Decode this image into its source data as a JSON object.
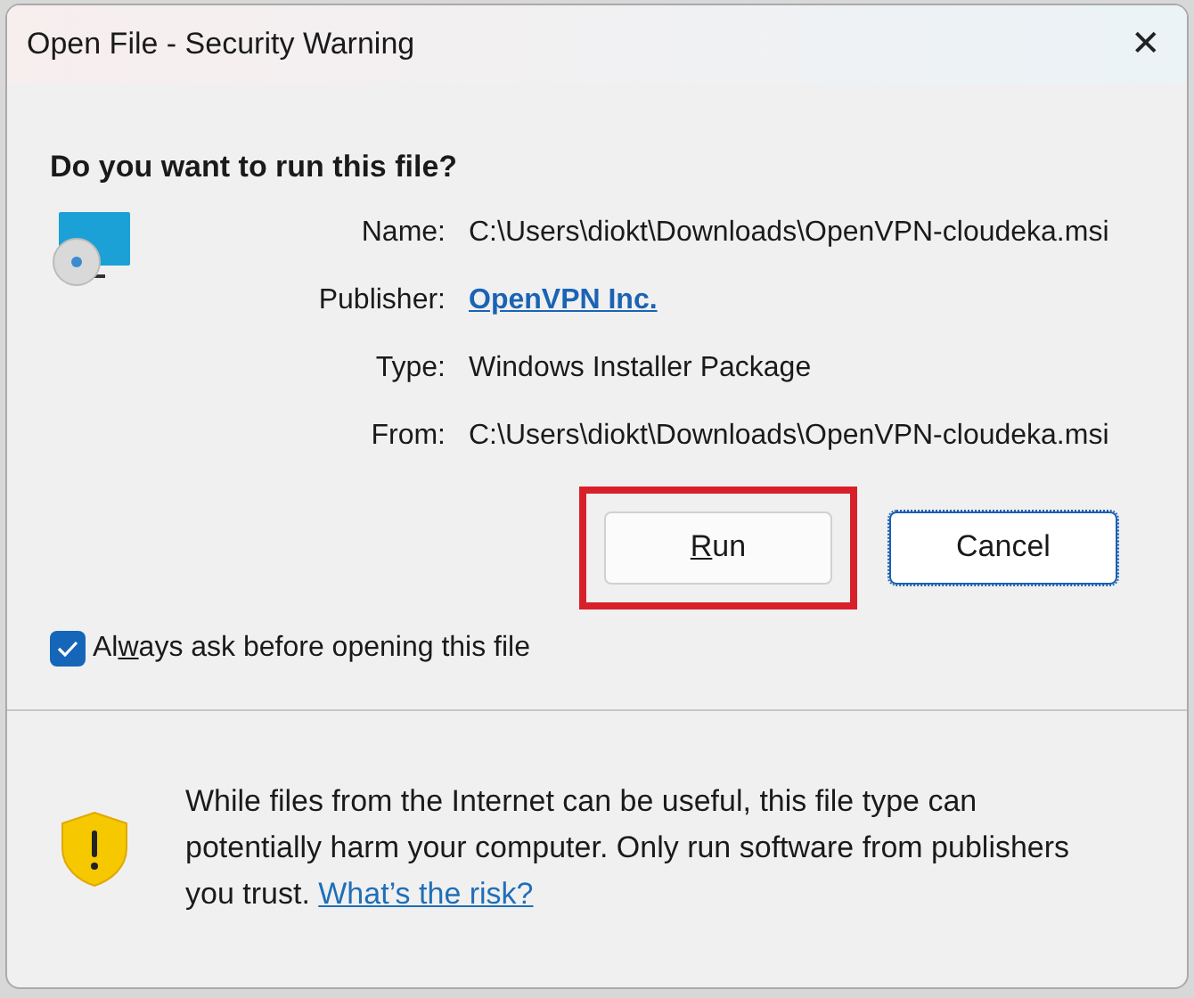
{
  "window": {
    "title": "Open File - Security Warning",
    "close_glyph": "✕"
  },
  "question": "Do you want to run this file?",
  "details": [
    {
      "label": "Name:",
      "value": "C:\\Users\\diokt\\Downloads\\OpenVPN-cloudeka.msi",
      "kind": "text"
    },
    {
      "label": "Publisher:",
      "value": "OpenVPN Inc.",
      "kind": "link"
    },
    {
      "label": "Type:",
      "value": "Windows Installer Package",
      "kind": "text"
    },
    {
      "label": "From:",
      "value": "C:\\Users\\diokt\\Downloads\\OpenVPN-cloudeka.msi",
      "kind": "text"
    }
  ],
  "buttons": [
    {
      "access_key": "R",
      "after": "un",
      "highlighted": true,
      "focused": false
    },
    {
      "before": "Cancel",
      "highlighted": false,
      "focused": true
    }
  ],
  "checkbox": {
    "before": "Al",
    "access_key": "w",
    "after": "ays ask before opening this file",
    "checked": true
  },
  "warning": {
    "text": "While files from the Internet can be useful, this file type can potentially harm your computer. Only run software from publishers you trust.",
    "link": "What’s the risk?"
  }
}
